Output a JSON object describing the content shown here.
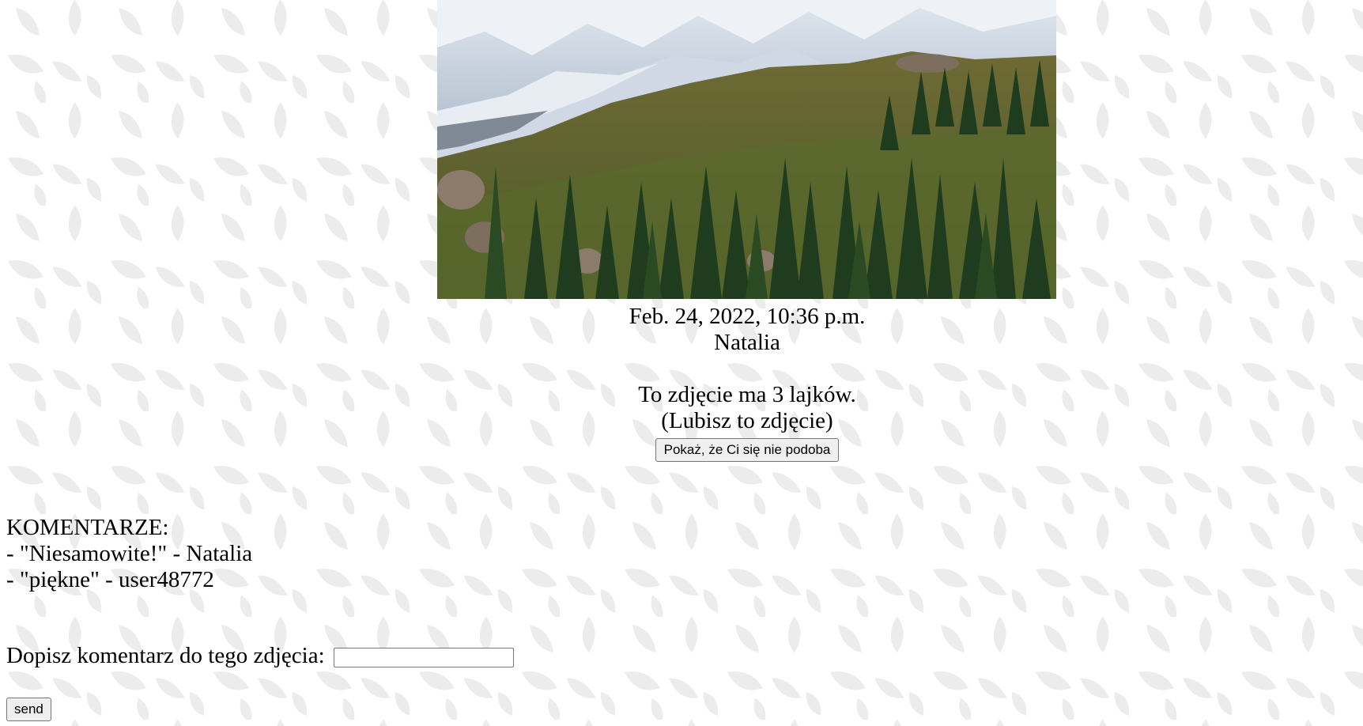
{
  "photo": {
    "alt": "mountain landscape photo"
  },
  "post": {
    "date": "Feb. 24, 2022, 10:36 p.m.",
    "author": "Natalia",
    "likes_text": "To zdjęcie ma 3 lajków.",
    "liked_status": "(Lubisz to zdjęcie)",
    "dislike_button_label": "Pokaż, że Ci się nie podoba"
  },
  "comments": {
    "heading": "KOMENTARZE:",
    "items": [
      {
        "text": "- \"Niesamowite!\" - Natalia"
      },
      {
        "text": "- \"piękne\" - user48772"
      }
    ]
  },
  "add_comment": {
    "label": "Dopisz komentarz do tego zdjęcia:",
    "value": "",
    "send_label": "send"
  },
  "colors": {
    "background": "#ffffff",
    "pattern_leaf": "#e9e9e9",
    "button_bg": "#efefef",
    "button_border": "#767676"
  }
}
